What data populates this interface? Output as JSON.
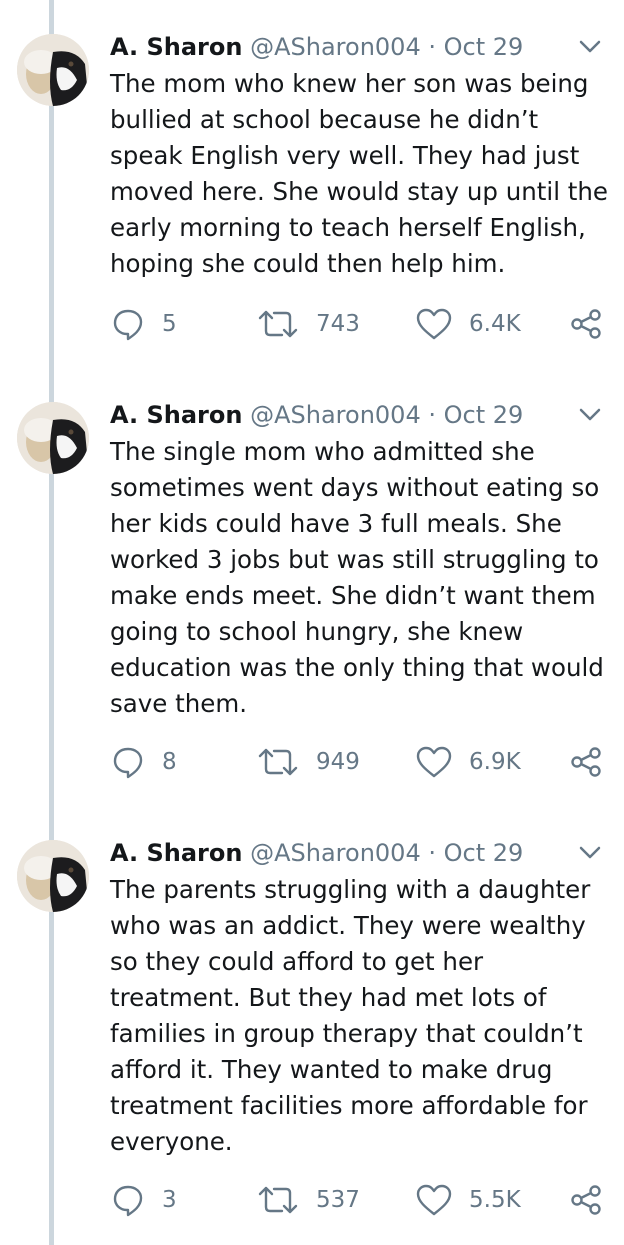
{
  "tweets": [
    {
      "author_name": "A. Sharon",
      "handle": "@ASharon004",
      "separator": "·",
      "date": "Oct 29",
      "text": "The mom who knew her son was being bullied at school because he didn’t speak English very well. They had just moved here. She would stay up until the early morning to teach herself English, hoping she could then help him.",
      "replies": "5",
      "retweets": "743",
      "likes": "6.4K"
    },
    {
      "author_name": "A. Sharon",
      "handle": "@ASharon004",
      "separator": "·",
      "date": "Oct 29",
      "text": "The single mom who admitted she sometimes went days without eating so her kids could have 3 full meals. She worked 3 jobs but was still struggling to make ends meet. She didn’t want them going to school hungry, she knew education was the only thing that would save them.",
      "replies": "8",
      "retweets": "949",
      "likes": "6.9K"
    },
    {
      "author_name": "A. Sharon",
      "handle": "@ASharon004",
      "separator": "·",
      "date": "Oct 29",
      "text": "The parents struggling with a daughter who was an addict. They were wealthy so they could afford to get her treatment. But they had met lots of families in group therapy that couldn’t afford it. They wanted to make drug treatment facilities more affordable for everyone.",
      "replies": "3",
      "retweets": "537",
      "likes": "5.5K"
    }
  ],
  "icons": {
    "reply": "reply-icon",
    "retweet": "retweet-icon",
    "like": "heart-icon",
    "share": "share-icon",
    "menu": "chevron-down-icon"
  },
  "colors": {
    "text": "#14171a",
    "secondary": "#657786",
    "thread_line": "#ccd6dd"
  }
}
